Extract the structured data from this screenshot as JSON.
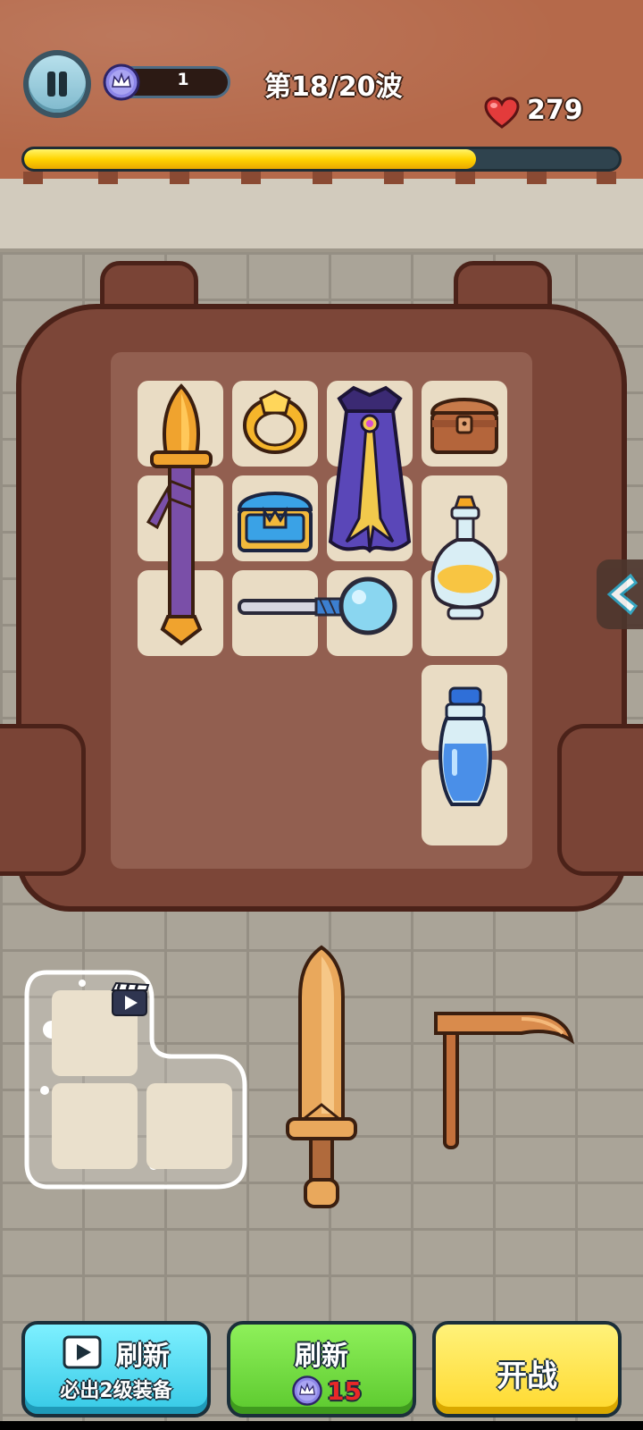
{
  "hud": {
    "gem_count": "1",
    "wave_label": "第18/20波",
    "hp": "279",
    "wave_progress": 0.76
  },
  "colors": {
    "progress_fill": "#ffd400",
    "btn_ad": "#5fe0f0",
    "btn_refresh": "#6ed83a",
    "btn_battle": "#ffe445",
    "gem_purple": "#8c86e8",
    "heart_red": "#e33b3b",
    "cost_red": "#e82828"
  },
  "backpack": {
    "items": [
      {
        "icon": "dagger-icon"
      },
      {
        "icon": "gold-ring-icon"
      },
      {
        "icon": "purple-cloak-icon"
      },
      {
        "icon": "wooden-chest-icon"
      },
      {
        "icon": "blue-gold-chest-icon"
      },
      {
        "icon": "yellow-potion-icon"
      },
      {
        "icon": "magnifying-staff-icon"
      },
      {
        "icon": "blue-potion-icon"
      }
    ]
  },
  "shop": {
    "offers": [
      {
        "icon": "video-ad-icon"
      },
      {
        "icon": "bronze-sword-icon"
      },
      {
        "icon": "pickaxe-icon"
      }
    ]
  },
  "buttons": {
    "ad_refresh": {
      "label": "刷新",
      "sub": "必出2级装备"
    },
    "refresh": {
      "label": "刷新",
      "cost": "15"
    },
    "battle": {
      "label": "开战"
    }
  }
}
